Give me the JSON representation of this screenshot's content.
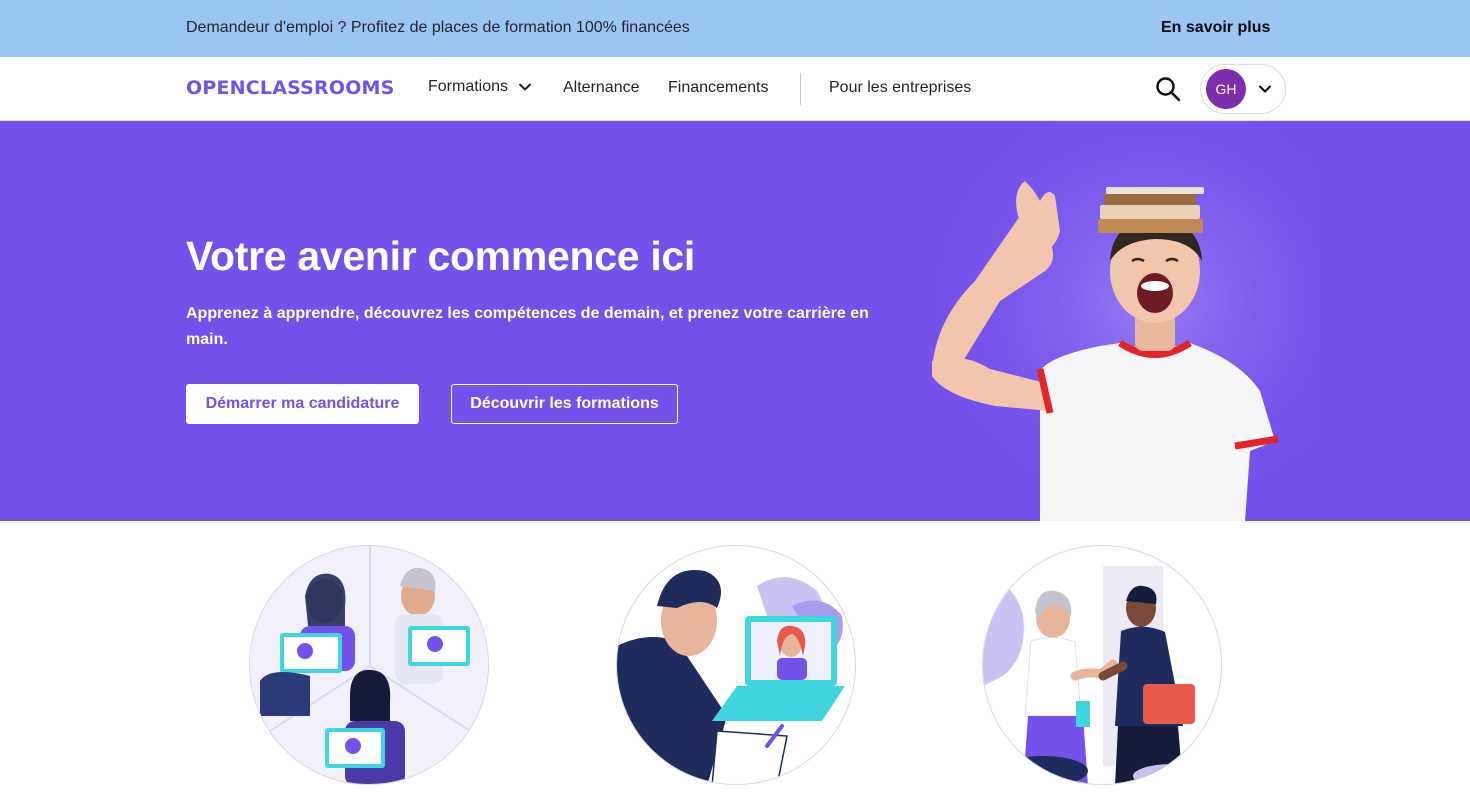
{
  "banner": {
    "text": "Demandeur d'emploi ? Profitez de places de formation 100% financées",
    "link": "En savoir plus"
  },
  "navbar": {
    "logo": "OPENCLASSROOMS",
    "items": [
      {
        "label": "Formations"
      },
      {
        "label": "Alternance"
      },
      {
        "label": "Financements"
      },
      {
        "label": "Pour les entreprises"
      }
    ],
    "account_initials": "GH"
  },
  "hero": {
    "title": "Votre avenir commence ici",
    "subtitle": "Apprenez à apprendre, découvrez les compétences de demain, et prenez votre carrière en main.",
    "primary_cta": "Démarrer ma candidature",
    "secondary_cta": "Découvrir les formations"
  },
  "colors": {
    "brand_purple": "#7451eb",
    "banner_blue": "#9bc6f2",
    "avatar_purple": "#7b2dae"
  },
  "illustrations": [
    {
      "icon": "certificates-illustration"
    },
    {
      "icon": "video-call-illustration"
    },
    {
      "icon": "handshake-illustration"
    }
  ]
}
